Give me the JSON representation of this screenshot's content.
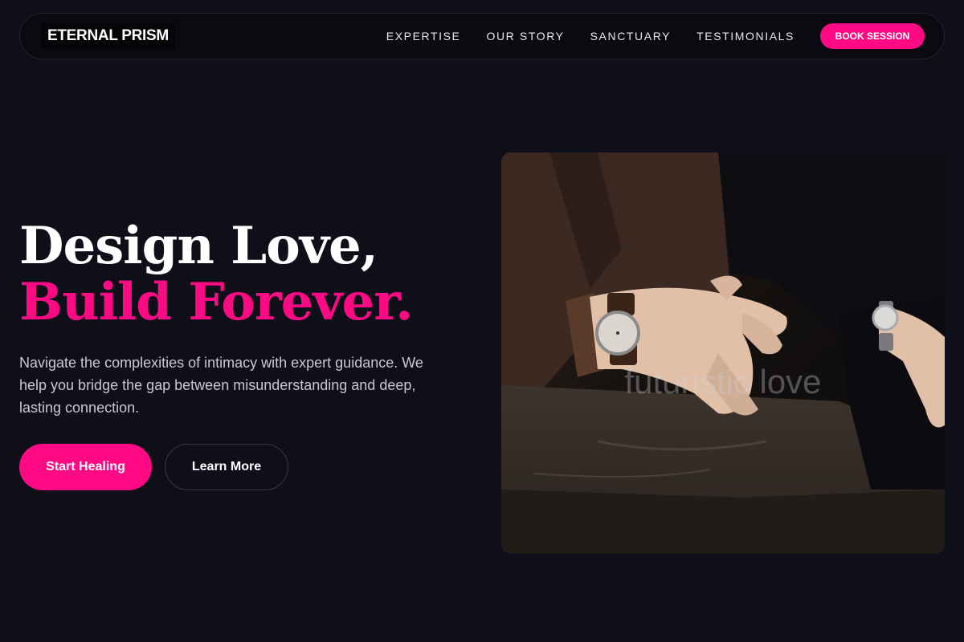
{
  "brand": {
    "name": "ETERNAL PRISM"
  },
  "nav": {
    "links": [
      "EXPERTISE",
      "OUR STORY",
      "SANCTUARY",
      "TESTIMONIALS"
    ],
    "cta": "BOOK SESSION"
  },
  "hero": {
    "title_line1": "Design Love,",
    "title_line2": "Build Forever.",
    "description": "Navigate the complexities of intimacy with expert guidance. We help you bridge the gap between misunderstanding and deep, lasting connection.",
    "primary_button": "Start Healing",
    "secondary_button": "Learn More"
  },
  "image": {
    "watermark": "futuristic love",
    "subject": "couple-hands-wristwatches-photo"
  },
  "colors": {
    "accent": "#ff0a84",
    "background": "#0f0f19",
    "navbar": "#0a0a10"
  }
}
